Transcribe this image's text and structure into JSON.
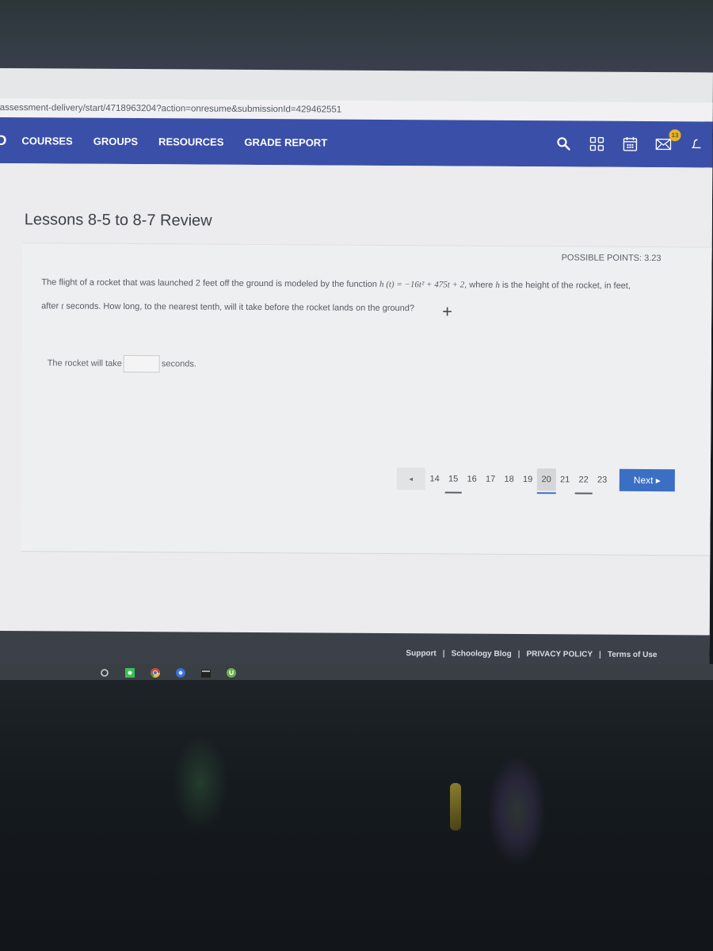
{
  "browser": {
    "url": "assessment-delivery/start/4718963204?action=onresume&submissionId=429462551"
  },
  "nav": {
    "logo": "D",
    "items": [
      {
        "label": "COURSES"
      },
      {
        "label": "GROUPS"
      },
      {
        "label": "RESOURCES"
      },
      {
        "label": "GRADE REPORT"
      }
    ],
    "icons": [
      {
        "name": "search-icon"
      },
      {
        "name": "grid-apps-icon"
      },
      {
        "name": "calendar-icon"
      },
      {
        "name": "mail-icon",
        "badge": "13"
      },
      {
        "name": "bell-icon"
      }
    ],
    "accent_color": "#3a4fa8",
    "badge_color": "#e4b52b"
  },
  "page": {
    "title": "Lessons 8-5 to 8-7 Review"
  },
  "question": {
    "possible_points": "POSSIBLE POINTS: 3.23",
    "text_part1": "The flight of a rocket that was launched 2 feet off the ground is modeled by the function ",
    "function": "h (t) = −16t² + 475t + 2",
    "text_part2": ", where ",
    "var_h": "h",
    "text_part3": " is the height of the rocket, in feet,",
    "text_line2_a": "after ",
    "var_t": "t",
    "text_line2_b": " seconds.  How long, to the nearest tenth, will it take before the rocket lands on the ground?",
    "answer_prefix": "The rocket will take",
    "answer_value": "",
    "answer_suffix": "seconds."
  },
  "pagination": {
    "prev_label": "◂",
    "pages": [
      {
        "num": "14",
        "state": "normal"
      },
      {
        "num": "15",
        "state": "answered"
      },
      {
        "num": "16",
        "state": "normal"
      },
      {
        "num": "17",
        "state": "normal"
      },
      {
        "num": "18",
        "state": "normal"
      },
      {
        "num": "19",
        "state": "normal"
      },
      {
        "num": "20",
        "state": "current"
      },
      {
        "num": "21",
        "state": "normal"
      },
      {
        "num": "22",
        "state": "answered"
      },
      {
        "num": "23",
        "state": "normal"
      }
    ],
    "next_label": "Next ▸",
    "next_color": "#3a6fc4"
  },
  "footer": {
    "links": [
      {
        "label": "Support"
      },
      {
        "label": "Schoology Blog"
      },
      {
        "label": "PRIVACY POLICY"
      },
      {
        "label": "Terms of Use"
      }
    ],
    "separator": "|"
  },
  "taskbar": {
    "apps": [
      {
        "name": "start-circle-icon",
        "color": "#cfd2d6"
      },
      {
        "name": "green-app-icon",
        "color": "#3cbf5a"
      },
      {
        "name": "chrome-icon",
        "color": "#d24a3c"
      },
      {
        "name": "blue-app-icon",
        "color": "#3b6fd0"
      },
      {
        "name": "terminal-icon",
        "color": "#222"
      },
      {
        "name": "utorrent-icon",
        "color": "#6ab04c"
      }
    ]
  }
}
